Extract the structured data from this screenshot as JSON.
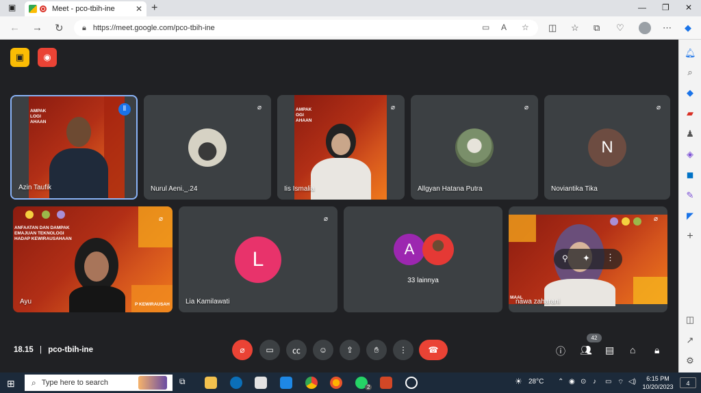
{
  "browser": {
    "tab_title": "Meet - pco-tbih-ine",
    "url": "https://meet.google.com/pco-tbih-ine"
  },
  "participants": [
    {
      "name": "Azin Taufik"
    },
    {
      "name": "Nurul Aeni._.24"
    },
    {
      "name": "Iis Ismalia"
    },
    {
      "name": "Allgyan Hatana Putra"
    },
    {
      "name": "Noviantika Tika",
      "initial": "N"
    },
    {
      "name": "Ayu"
    },
    {
      "name": "Lia Kamilawati",
      "initial": "L"
    },
    {
      "name": "nawa zaharani"
    }
  ],
  "others": {
    "label": "33 lainnya",
    "initial": "A"
  },
  "video_banners": {
    "tile1": "AMPAK\nLOGI\nAHAAN",
    "tile3": "AMPAK\nOGI\nAHAAN",
    "tile6": "ANFAATAN DAN DAMPAK\nEMAJUAN TEKNOLOGI\nHADAP KEWIRAUSAHAAN",
    "tile6_bottom": "P KEWIRAUSAH",
    "tile8_side": "MAAL"
  },
  "meeting": {
    "time": "18.15",
    "separator": "|",
    "code": "pco-tbih-ine",
    "people_count": "42"
  },
  "taskbar": {
    "search_placeholder": "Type here to search",
    "temperature": "28°C",
    "time": "6:15 PM",
    "date": "10/20/2023",
    "notification_count": "4",
    "whatsapp_badge": "2"
  },
  "colors": {
    "meet_bg": "#202124",
    "tile_bg": "#3c4043",
    "red": "#ea4335",
    "active_border": "#8ab4f8"
  }
}
